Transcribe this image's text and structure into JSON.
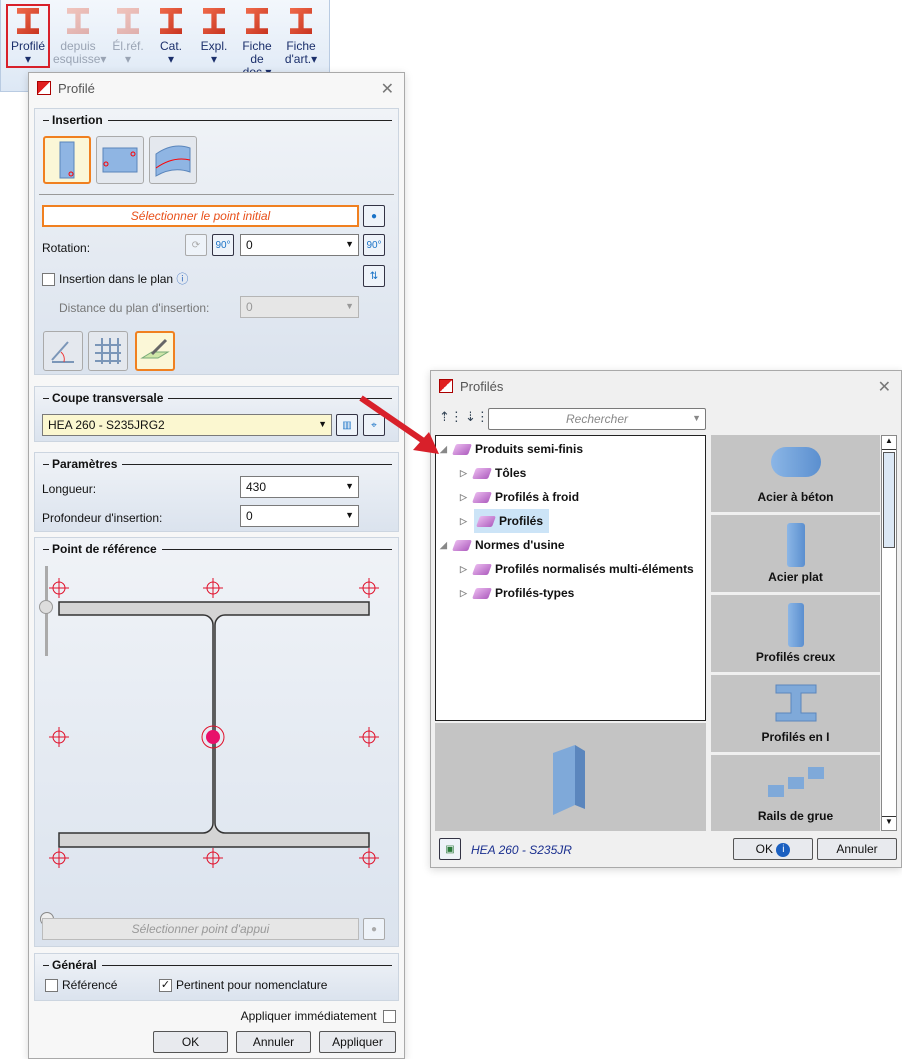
{
  "ribbon": {
    "buttons": [
      {
        "label1": "Profilé",
        "label2": "",
        "disabled": false
      },
      {
        "label1": "depuis",
        "label2": "esquisse",
        "disabled": true
      },
      {
        "label1": "Él.réf.",
        "label2": "",
        "disabled": true
      },
      {
        "label1": "Cat.",
        "label2": "",
        "disabled": false
      },
      {
        "label1": "Expl.",
        "label2": "",
        "disabled": false
      },
      {
        "label1": "Fiche de",
        "label2": "doc.",
        "disabled": false
      },
      {
        "label1": "Fiche",
        "label2": "d'art.",
        "disabled": false
      }
    ]
  },
  "profile_dialog": {
    "title": "Profilé",
    "insertion": {
      "heading": "Insertion",
      "select_point": "Sélectionner le point initial",
      "rotation_label": "Rotation:",
      "rotation_value": "0",
      "in_plane_label": "Insertion dans le plan",
      "in_plane_checked": false,
      "distance_label": "Distance du plan d'insertion:",
      "distance_value": "0"
    },
    "cross_section": {
      "heading": "Coupe transversale",
      "value": "HEA 260 - S235JRG2"
    },
    "parameters": {
      "heading": "Paramètres",
      "length_label": "Longueur:",
      "length_value": "430",
      "depth_label": "Profondeur d'insertion:",
      "depth_value": "0"
    },
    "reference_point": {
      "heading": "Point de référence",
      "select_support": "Sélectionner point d'appui"
    },
    "general": {
      "heading": "Général",
      "referenced_label": "Référencé",
      "referenced_checked": false,
      "bom_label": "Pertinent pour nomenclature",
      "bom_checked": true
    },
    "apply_immediately": "Appliquer immédiatement",
    "ok": "OK",
    "cancel": "Annuler",
    "apply": "Appliquer"
  },
  "profiles_dialog": {
    "title": "Profilés",
    "search_placeholder": "Rechercher",
    "tree": [
      {
        "label": "Produits semi-finis",
        "level": 0,
        "expanded": true
      },
      {
        "label": "Tôles",
        "level": 1
      },
      {
        "label": "Profilés à froid",
        "level": 1
      },
      {
        "label": "Profilés",
        "level": 1,
        "selected": true
      },
      {
        "label": "Normes d'usine",
        "level": 0,
        "expanded": true
      },
      {
        "label": "Profilés normalisés multi-éléments",
        "level": 1
      },
      {
        "label": "Profilés-types",
        "level": 1
      }
    ],
    "tiles": [
      "Acier à béton",
      "Acier plat",
      "Profilés creux",
      "Profilés en I",
      "Rails de grue"
    ],
    "current": "HEA 260 - S235JR",
    "ok": "OK",
    "cancel": "Annuler"
  },
  "colors": {
    "accent_orange": "#f08020",
    "red": "#d8202a",
    "selection": "#cce4f7"
  }
}
